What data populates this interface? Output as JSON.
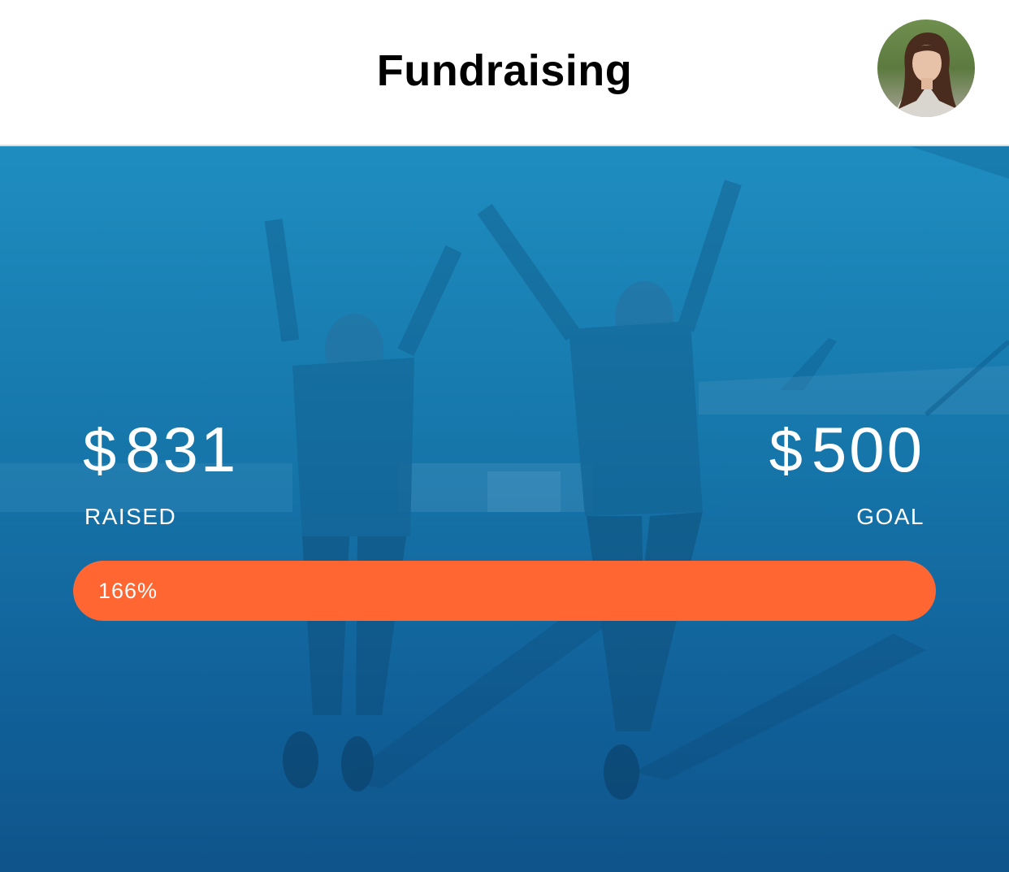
{
  "header": {
    "title": "Fundraising",
    "avatar_icon": "user-avatar-photo"
  },
  "fundraising": {
    "raised": {
      "currency": "$",
      "amount": "831",
      "label": "RAISED"
    },
    "goal": {
      "currency": "$",
      "amount": "500",
      "label": "GOAL"
    },
    "progress": {
      "text": "166%",
      "fill_fraction": 1.0
    }
  },
  "colors": {
    "accent": "#ff6631",
    "hero_top": "#1f8dc0",
    "hero_bottom": "#0f548b"
  }
}
